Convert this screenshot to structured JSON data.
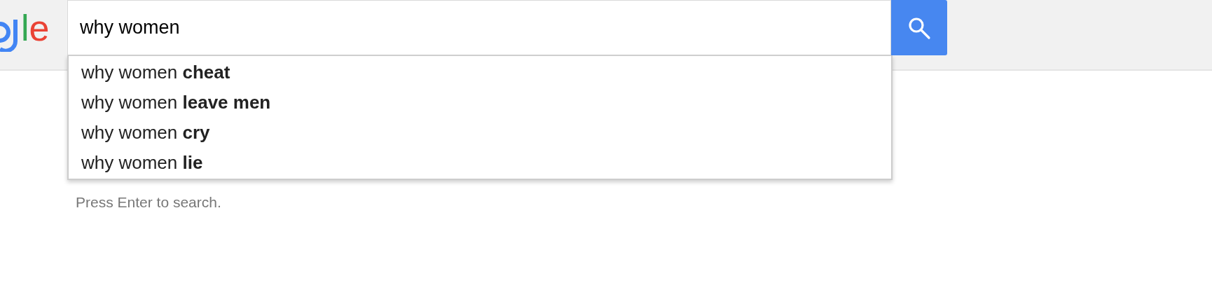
{
  "logo": [
    {
      "text": "l",
      "color": "#34a853"
    },
    {
      "text": "e",
      "color": "#ea4335"
    }
  ],
  "search": {
    "value": "why women"
  },
  "suggestions": [
    {
      "text": "why women **cheat**"
    },
    {
      "text": "why women **leave men**"
    },
    {
      "text": "why women **cry**"
    },
    {
      "text": "why women **lie**"
    }
  ],
  "hint": "Press Enter to search."
}
